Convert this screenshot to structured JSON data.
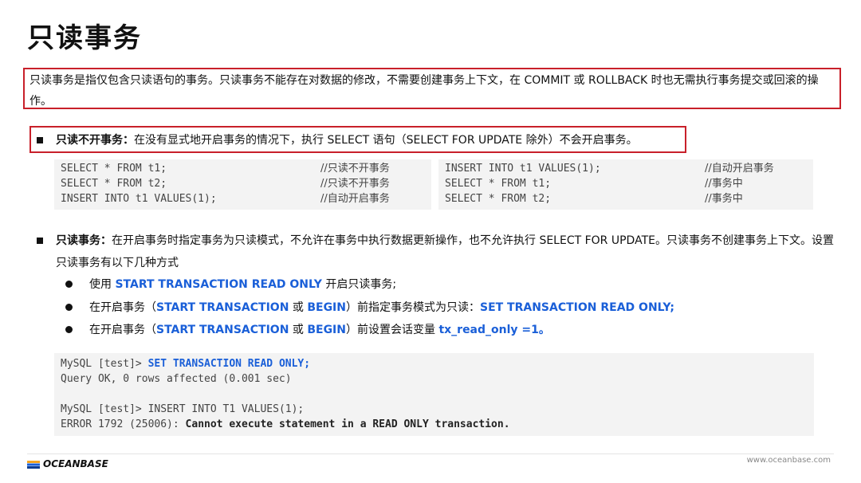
{
  "title": "只读事务",
  "intro": "只读事务是指仅包含只读语句的事务。只读事务不能存在对数据的修改，不需要创建事务上下文，在 COMMIT 或 ROLLBACK 时也无需执行事务提交或回滚的操作。",
  "point1": {
    "label": "只读不开事务：",
    "text": "在没有显式地开启事务的情况下，执行 SELECT 语句（SELECT FOR UPDATE 除外）不会开启事务。"
  },
  "code_left": [
    {
      "code": "SELECT * FROM t1;",
      "comment": "//只读不开事务"
    },
    {
      "code": "SELECT * FROM t2;",
      "comment": "//只读不开事务"
    },
    {
      "code": "INSERT INTO t1 VALUES(1);",
      "comment": "//自动开启事务"
    }
  ],
  "code_right": [
    {
      "code": "INSERT INTO t1 VALUES(1);",
      "comment": "//自动开启事务"
    },
    {
      "code": "SELECT * FROM t1;",
      "comment": "//事务中"
    },
    {
      "code": "SELECT * FROM t2;",
      "comment": "//事务中"
    }
  ],
  "point2": {
    "label": "只读事务：",
    "text": "在开启事务时指定事务为只读模式，不允许在事务中执行数据更新操作，也不允许执行 SELECT FOR UPDATE。只读事务不创建事务上下文。设置只读事务有以下几种方式"
  },
  "methods": [
    {
      "pre": "使用 ",
      "kw1": "START TRANSACTION READ ONLY",
      "mid": " 开启只读事务;",
      "kw2": "",
      "mid2": "",
      "kw3": "",
      "post": ""
    },
    {
      "pre": "在开启事务（",
      "kw1": "START TRANSACTION",
      "mid": " 或 ",
      "kw2": "BEGIN",
      "mid2": "）前指定事务模式为只读：",
      "kw3": "SET TRANSACTION READ ONLY;",
      "post": ""
    },
    {
      "pre": "在开启事务（",
      "kw1": "START TRANSACTION",
      "mid": " 或 ",
      "kw2": "BEGIN",
      "mid2": "）前设置会话变量 ",
      "kw3": "tx_read_only =1",
      "post": "。"
    }
  ],
  "console": {
    "prompt1": "MySQL [test]> ",
    "cmd1": "SET TRANSACTION READ ONLY;",
    "out1": "Query OK, 0 rows affected (0.001 sec)",
    "prompt2": "MySQL [test]> ",
    "cmd2": "INSERT INTO T1 VALUES(1);",
    "err_code": "ERROR 1792 (25006): ",
    "err_msg": "Cannot execute statement in a READ ONLY transaction."
  },
  "footer": {
    "logo_text": "OCEANBASE",
    "website": "www.oceanbase.com"
  },
  "colors": {
    "accent_blue": "#1a5fd8",
    "highlight_red": "#c8202a",
    "code_bg": "#f3f3f3"
  }
}
